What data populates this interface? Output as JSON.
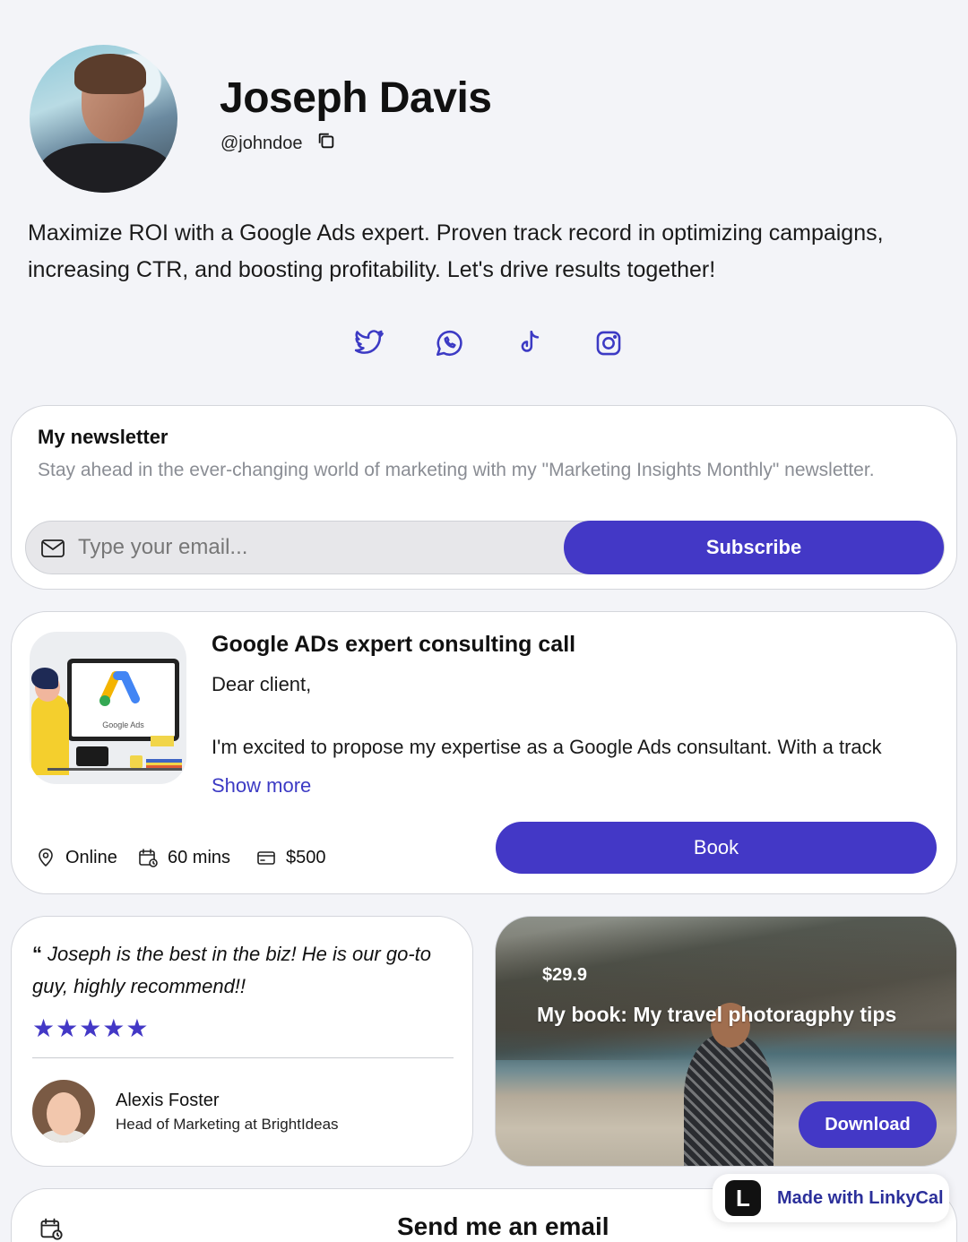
{
  "profile": {
    "name": "Joseph Davis",
    "handle": "@johndoe",
    "bio": "Maximize ROI with a Google Ads expert. Proven track record in optimizing campaigns, increasing CTR, and boosting profitability. Let's drive results together!"
  },
  "socials": [
    "twitter-icon",
    "whatsapp-icon",
    "tiktok-icon",
    "instagram-icon"
  ],
  "newsletter": {
    "title": "My newsletter",
    "description": "Stay ahead in the ever-changing world of marketing with my \"Marketing Insights Monthly\" newsletter.",
    "email_placeholder": "Type your email...",
    "subscribe_label": "Subscribe"
  },
  "consulting": {
    "thumb_label": "Google Ads",
    "title": "Google ADs expert consulting call",
    "greeting": "Dear client,",
    "excerpt": "I'm excited to propose my expertise as a Google Ads consultant. With a track",
    "show_more": "Show more",
    "location": "Online",
    "duration": "60 mins",
    "price": "$500",
    "book_label": "Book"
  },
  "testimonial": {
    "quote_mark": "“",
    "quote": "Joseph is the best in the biz! He is our go-to guy, highly recommend!!",
    "stars": "★★★★★",
    "rating": 5,
    "author": "Alexis Foster",
    "role": "Head of Marketing at BrightIdeas"
  },
  "book": {
    "price": "$29.9",
    "title": "My book: My travel photoragphy tips",
    "download_label": "Download"
  },
  "email_card": {
    "title": "Send me an email"
  },
  "badge": {
    "logo_letter": "L",
    "text": "Made with LinkyCal"
  },
  "colors": {
    "accent": "#4338c6",
    "background": "#f3f4f8"
  }
}
